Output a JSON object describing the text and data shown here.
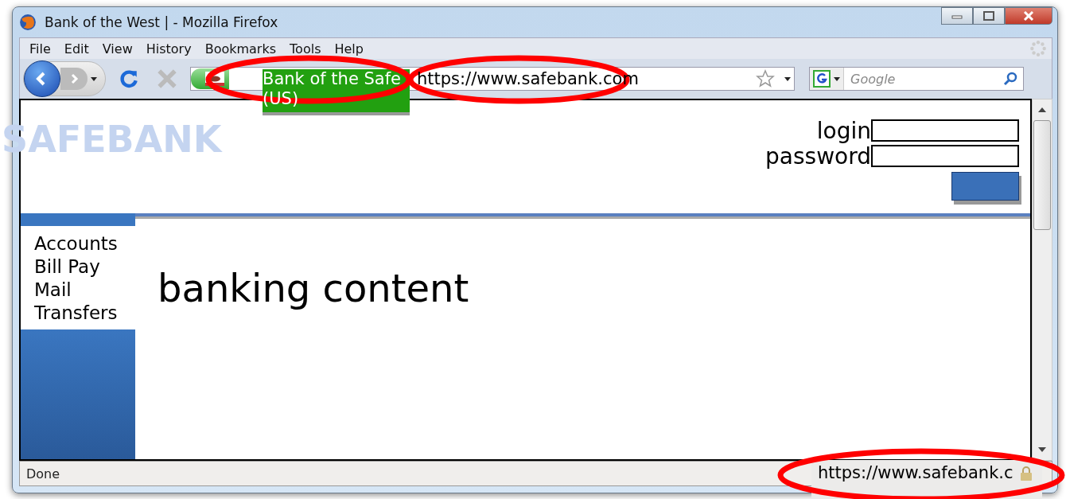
{
  "window": {
    "title": "Bank of the West | - Mozilla Firefox"
  },
  "menu": [
    "File",
    "Edit",
    "View",
    "History",
    "Bookmarks",
    "Tools",
    "Help"
  ],
  "address_bar": {
    "url": "https://www.safebank.com"
  },
  "search": {
    "placeholder": "Google"
  },
  "spoof_identity": {
    "label": "Bank of the Safe (US)"
  },
  "page": {
    "logo": "SAFEBANK",
    "login_label": "login",
    "password_label": "password",
    "nav": [
      "Accounts",
      "Bill Pay",
      "Mail",
      "Transfers"
    ],
    "heading": "banking content"
  },
  "status_bar": {
    "text": "Done"
  },
  "spoof_status": {
    "url": "https://www.safebank.c"
  }
}
